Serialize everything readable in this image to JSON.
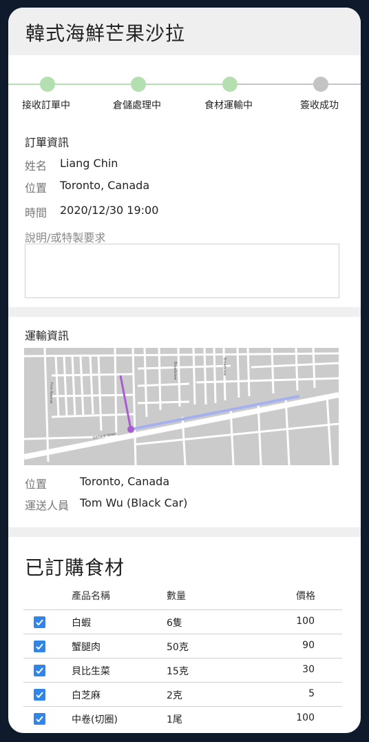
{
  "header": {
    "title": "韓式海鮮芒果沙拉"
  },
  "stepper": {
    "steps": [
      {
        "label": "接收訂單中",
        "state": "done"
      },
      {
        "label": "倉儲處理中",
        "state": "done"
      },
      {
        "label": "食材運輸中",
        "state": "done"
      },
      {
        "label": "簽收成功",
        "state": "pending"
      }
    ],
    "colors": {
      "done": "#b4dfb0",
      "pending": "#c4c4c4"
    }
  },
  "order": {
    "section_title": "訂單資訊",
    "name_label": "姓名",
    "name_value": "Liang Chin",
    "location_label": "位置",
    "location_value": "Toronto, Canada",
    "time_label": "時間",
    "time_value": "2020/12/30 19:00",
    "note_label": "說明/或特製要求",
    "note_value": ""
  },
  "shipping": {
    "section_title": "運輸資訊",
    "map": {
      "street_labels": [
        "Gerrard Street",
        "First Avenue",
        "Broadview"
      ],
      "route_colors": {
        "primary": "#a4b0f0",
        "secondary": "#a95bd1"
      }
    },
    "location_label": "位置",
    "location_value": "Toronto, Canada",
    "driver_label": "運送人員",
    "driver_value": "Tom Wu (Black Car)"
  },
  "ingredients": {
    "title": "已訂購食材",
    "columns": {
      "name": "產品名稱",
      "qty": "數量",
      "price": "價格"
    },
    "rows": [
      {
        "checked": true,
        "name": "白蝦",
        "qty": "6隻",
        "price": "100"
      },
      {
        "checked": true,
        "name": "蟹腿肉",
        "qty": "50克",
        "price": "90"
      },
      {
        "checked": true,
        "name": "貝比生菜",
        "qty": "15克",
        "price": "30"
      },
      {
        "checked": true,
        "name": "白芝麻",
        "qty": "2克",
        "price": "5"
      },
      {
        "checked": true,
        "name": "中卷(切圈)",
        "qty": "1尾",
        "price": "100"
      }
    ]
  }
}
